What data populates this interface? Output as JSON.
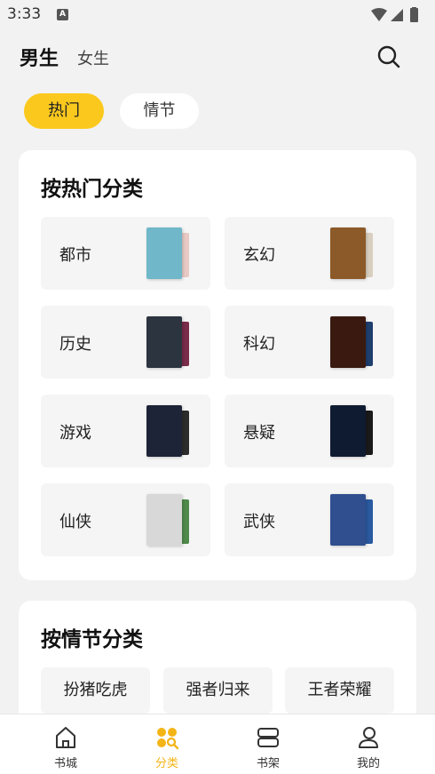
{
  "status": {
    "time": "3:33",
    "app_badge": "A"
  },
  "header": {
    "tab_male": "男生",
    "tab_female": "女生"
  },
  "filters": {
    "hot": "热门",
    "plot": "情节"
  },
  "hot_section": {
    "title": "按热门分类",
    "categories": [
      {
        "label": "都市",
        "cover_colors": [
          "#6fb7c9",
          "#e8c9c4"
        ]
      },
      {
        "label": "玄幻",
        "cover_colors": [
          "#8c5a28",
          "#d9cfc0"
        ]
      },
      {
        "label": "历史",
        "cover_colors": [
          "#2c3440",
          "#7a2c4a"
        ]
      },
      {
        "label": "科幻",
        "cover_colors": [
          "#3a1a10",
          "#1e3e6e"
        ]
      },
      {
        "label": "游戏",
        "cover_colors": [
          "#1d2438",
          "#2c2c2c"
        ]
      },
      {
        "label": "悬疑",
        "cover_colors": [
          "#0f1b30",
          "#1a1a1a"
        ]
      },
      {
        "label": "仙侠",
        "cover_colors": [
          "#d8d8d8",
          "#4f8a4a"
        ]
      },
      {
        "label": "武侠",
        "cover_colors": [
          "#2f4f8f",
          "#2a5aa0"
        ]
      }
    ]
  },
  "plot_section": {
    "title": "按情节分类",
    "tags": [
      "扮猪吃虎",
      "强者归来",
      "王者荣耀"
    ]
  },
  "bottom_nav": [
    {
      "label": "书城",
      "icon": "home-icon"
    },
    {
      "label": "分类",
      "icon": "category-icon",
      "active": true
    },
    {
      "label": "书架",
      "icon": "bookshelf-icon"
    },
    {
      "label": "我的",
      "icon": "profile-icon"
    }
  ],
  "colors": {
    "accent": "#fbc91e",
    "background": "#f2f2f2",
    "card": "#ffffff"
  }
}
